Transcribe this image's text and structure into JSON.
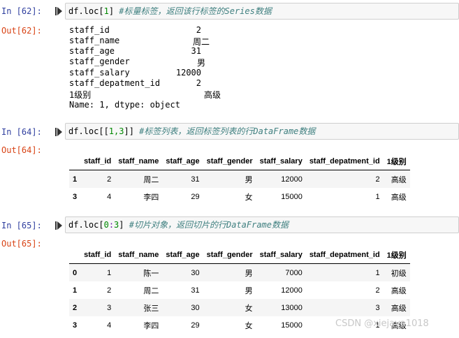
{
  "cells": [
    {
      "in_prompt": "In  [62]:",
      "out_prompt": "Out[62]:",
      "code_main": "df.loc[",
      "code_num": "1",
      "code_close": "]",
      "code_comment": " #标量标签，返回该行标签的Series数据",
      "series": {
        "rows": [
          {
            "label": "staff_id",
            "value": "2"
          },
          {
            "label": "staff_name",
            "value": "周二"
          },
          {
            "label": "staff_age",
            "value": "31"
          },
          {
            "label": "staff_gender",
            "value": "男"
          },
          {
            "label": "staff_salary",
            "value": "12000"
          },
          {
            "label": "staff_depatment_id",
            "value": "2"
          },
          {
            "label": "1级别",
            "value": "高级"
          }
        ],
        "footer": "Name: 1, dtype: object"
      }
    },
    {
      "in_prompt": "In  [64]:",
      "out_prompt": "Out[64]:",
      "code_main": "df.loc[[",
      "code_num": "1,3",
      "code_close": "]]",
      "code_comment": " #标签列表，返回标签列表的行DataFrame数据",
      "table": {
        "columns": [
          "",
          "staff_id",
          "staff_name",
          "staff_age",
          "staff_gender",
          "staff_salary",
          "staff_depatment_id",
          "1级别"
        ],
        "rows": [
          [
            "1",
            "2",
            "周二",
            "31",
            "男",
            "12000",
            "2",
            "高级"
          ],
          [
            "3",
            "4",
            "李四",
            "29",
            "女",
            "15000",
            "1",
            "高级"
          ]
        ]
      }
    },
    {
      "in_prompt": "In  [65]:",
      "out_prompt": "Out[65]:",
      "code_main": "df.loc[",
      "code_num": "0",
      "code_op": ":",
      "code_num2": "3",
      "code_close": "]",
      "code_comment": " #切片对象，返回切片的行DataFrame数据",
      "table": {
        "columns": [
          "",
          "staff_id",
          "staff_name",
          "staff_age",
          "staff_gender",
          "staff_salary",
          "staff_depatment_id",
          "1级别"
        ],
        "rows": [
          [
            "0",
            "1",
            "陈一",
            "30",
            "男",
            "7000",
            "1",
            "初级"
          ],
          [
            "1",
            "2",
            "周二",
            "31",
            "男",
            "12000",
            "2",
            "高级"
          ],
          [
            "2",
            "3",
            "张三",
            "30",
            "女",
            "13000",
            "3",
            "高级"
          ],
          [
            "3",
            "4",
            "李四",
            "29",
            "女",
            "15000",
            "1",
            "高级"
          ]
        ]
      }
    }
  ],
  "watermark": "CSDN @xiejava1018"
}
